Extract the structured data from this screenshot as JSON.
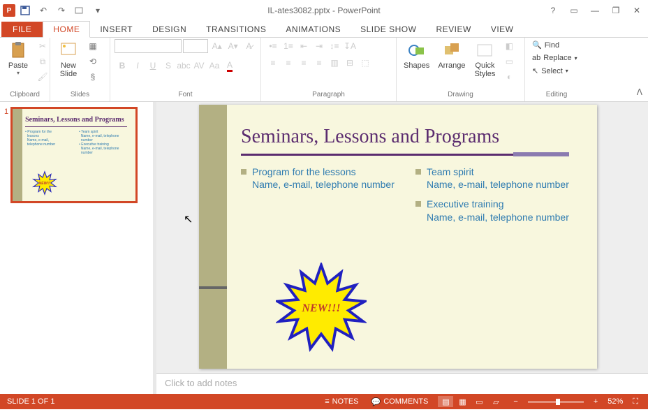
{
  "titlebar": {
    "title": "IL-ates3082.pptx - PowerPoint"
  },
  "tabs": {
    "file": "FILE",
    "home": "HOME",
    "insert": "INSERT",
    "design": "DESIGN",
    "transitions": "TRANSITIONS",
    "animations": "ANIMATIONS",
    "slideshow": "SLIDE SHOW",
    "review": "REVIEW",
    "view": "VIEW"
  },
  "ribbon": {
    "clipboard": {
      "paste": "Paste",
      "label": "Clipboard"
    },
    "slides": {
      "new_slide": "New\nSlide",
      "label": "Slides"
    },
    "font": {
      "label": "Font"
    },
    "paragraph": {
      "label": "Paragraph"
    },
    "drawing": {
      "shapes": "Shapes",
      "arrange": "Arrange",
      "quick": "Quick\nStyles",
      "label": "Drawing"
    },
    "editing": {
      "find": "Find",
      "replace": "Replace",
      "select": "Select",
      "label": "Editing"
    }
  },
  "slide": {
    "title": "Seminars, Lessons and Programs",
    "col1": [
      {
        "t": "Program for the lessons",
        "s": "Name, e-mail, telephone number"
      }
    ],
    "col2": [
      {
        "t": "Team spirit",
        "s": "Name, e-mail, telephone number"
      },
      {
        "t": "Executive training",
        "s": "Name, e-mail, telephone number"
      }
    ],
    "star": "NEW!!!"
  },
  "thumb": {
    "num": "1"
  },
  "notes": {
    "placeholder": "Click to add notes"
  },
  "status": {
    "slide_info": "SLIDE 1 OF 1",
    "notes": "NOTES",
    "comments": "COMMENTS",
    "zoom": "52%"
  }
}
